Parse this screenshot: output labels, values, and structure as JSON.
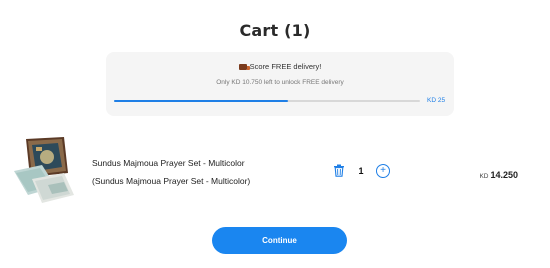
{
  "cart": {
    "title": "Cart (1)"
  },
  "delivery": {
    "score_text": "Score FREE delivery!",
    "remaining_text": "Only KD 10.750 left to unlock FREE delivery",
    "target_label": "KD 25",
    "progress_fraction": 0.57,
    "icon": "truck-icon"
  },
  "item": {
    "name": "Sundus Majmoua Prayer Set - Multicolor",
    "variant": "(Sundus Majmoua Prayer Set - Multicolor)",
    "quantity": "1",
    "price_currency": "KD",
    "price_amount": "14.250",
    "delete_icon": "trash-icon",
    "increase_icon": "plus-circle-icon"
  },
  "actions": {
    "continue_label": "Continue"
  },
  "colors": {
    "accent": "#1a86f0",
    "progress_track": "#d8d8d8",
    "delivery_bg": "#f5f5f5"
  }
}
